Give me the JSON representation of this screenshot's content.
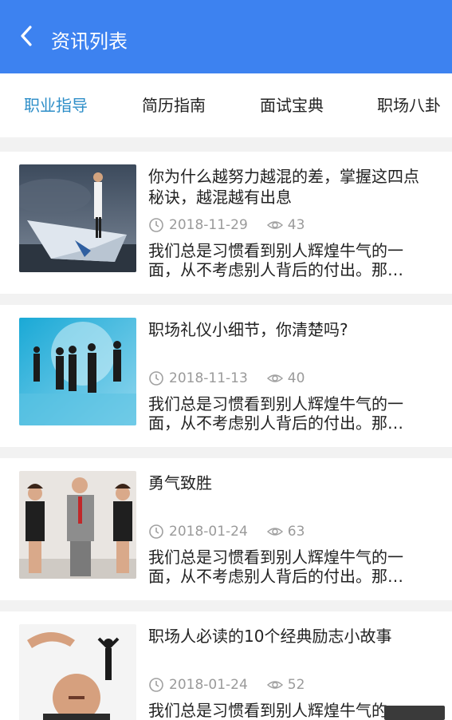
{
  "header": {
    "title": "资讯列表",
    "back_icon": "chevron-left-icon",
    "color": "#3d82f0"
  },
  "tabs": [
    {
      "label": "职业指导",
      "active": true
    },
    {
      "label": "简历指南",
      "active": false
    },
    {
      "label": "面试宝典",
      "active": false
    },
    {
      "label": "职场八卦",
      "active": false
    }
  ],
  "accent": "#2d8ec8",
  "articles": [
    {
      "title": "你为什么越努力越混的差，掌握这四点秘诀，越混越有出息",
      "date": "2018-11-29",
      "views": "43",
      "summary": "我们总是习惯看到别人辉煌牛气的一面，从不考虑别人背后的付出。那…"
    },
    {
      "title": "职场礼仪小细节，你清楚吗?",
      "date": "2018-11-13",
      "views": "40",
      "summary": "我们总是习惯看到别人辉煌牛气的一面，从不考虑别人背后的付出。那…"
    },
    {
      "title": "勇气致胜",
      "date": "2018-01-24",
      "views": "63",
      "summary": "我们总是习惯看到别人辉煌牛气的一面，从不考虑别人背后的付出。那…"
    },
    {
      "title": "职场人必读的10个经典励志小故事",
      "date": "2018-01-24",
      "views": "52",
      "summary": "我们总是习惯看到别人辉煌牛气的一面，从不考虑别人背后的付出。那…"
    }
  ]
}
